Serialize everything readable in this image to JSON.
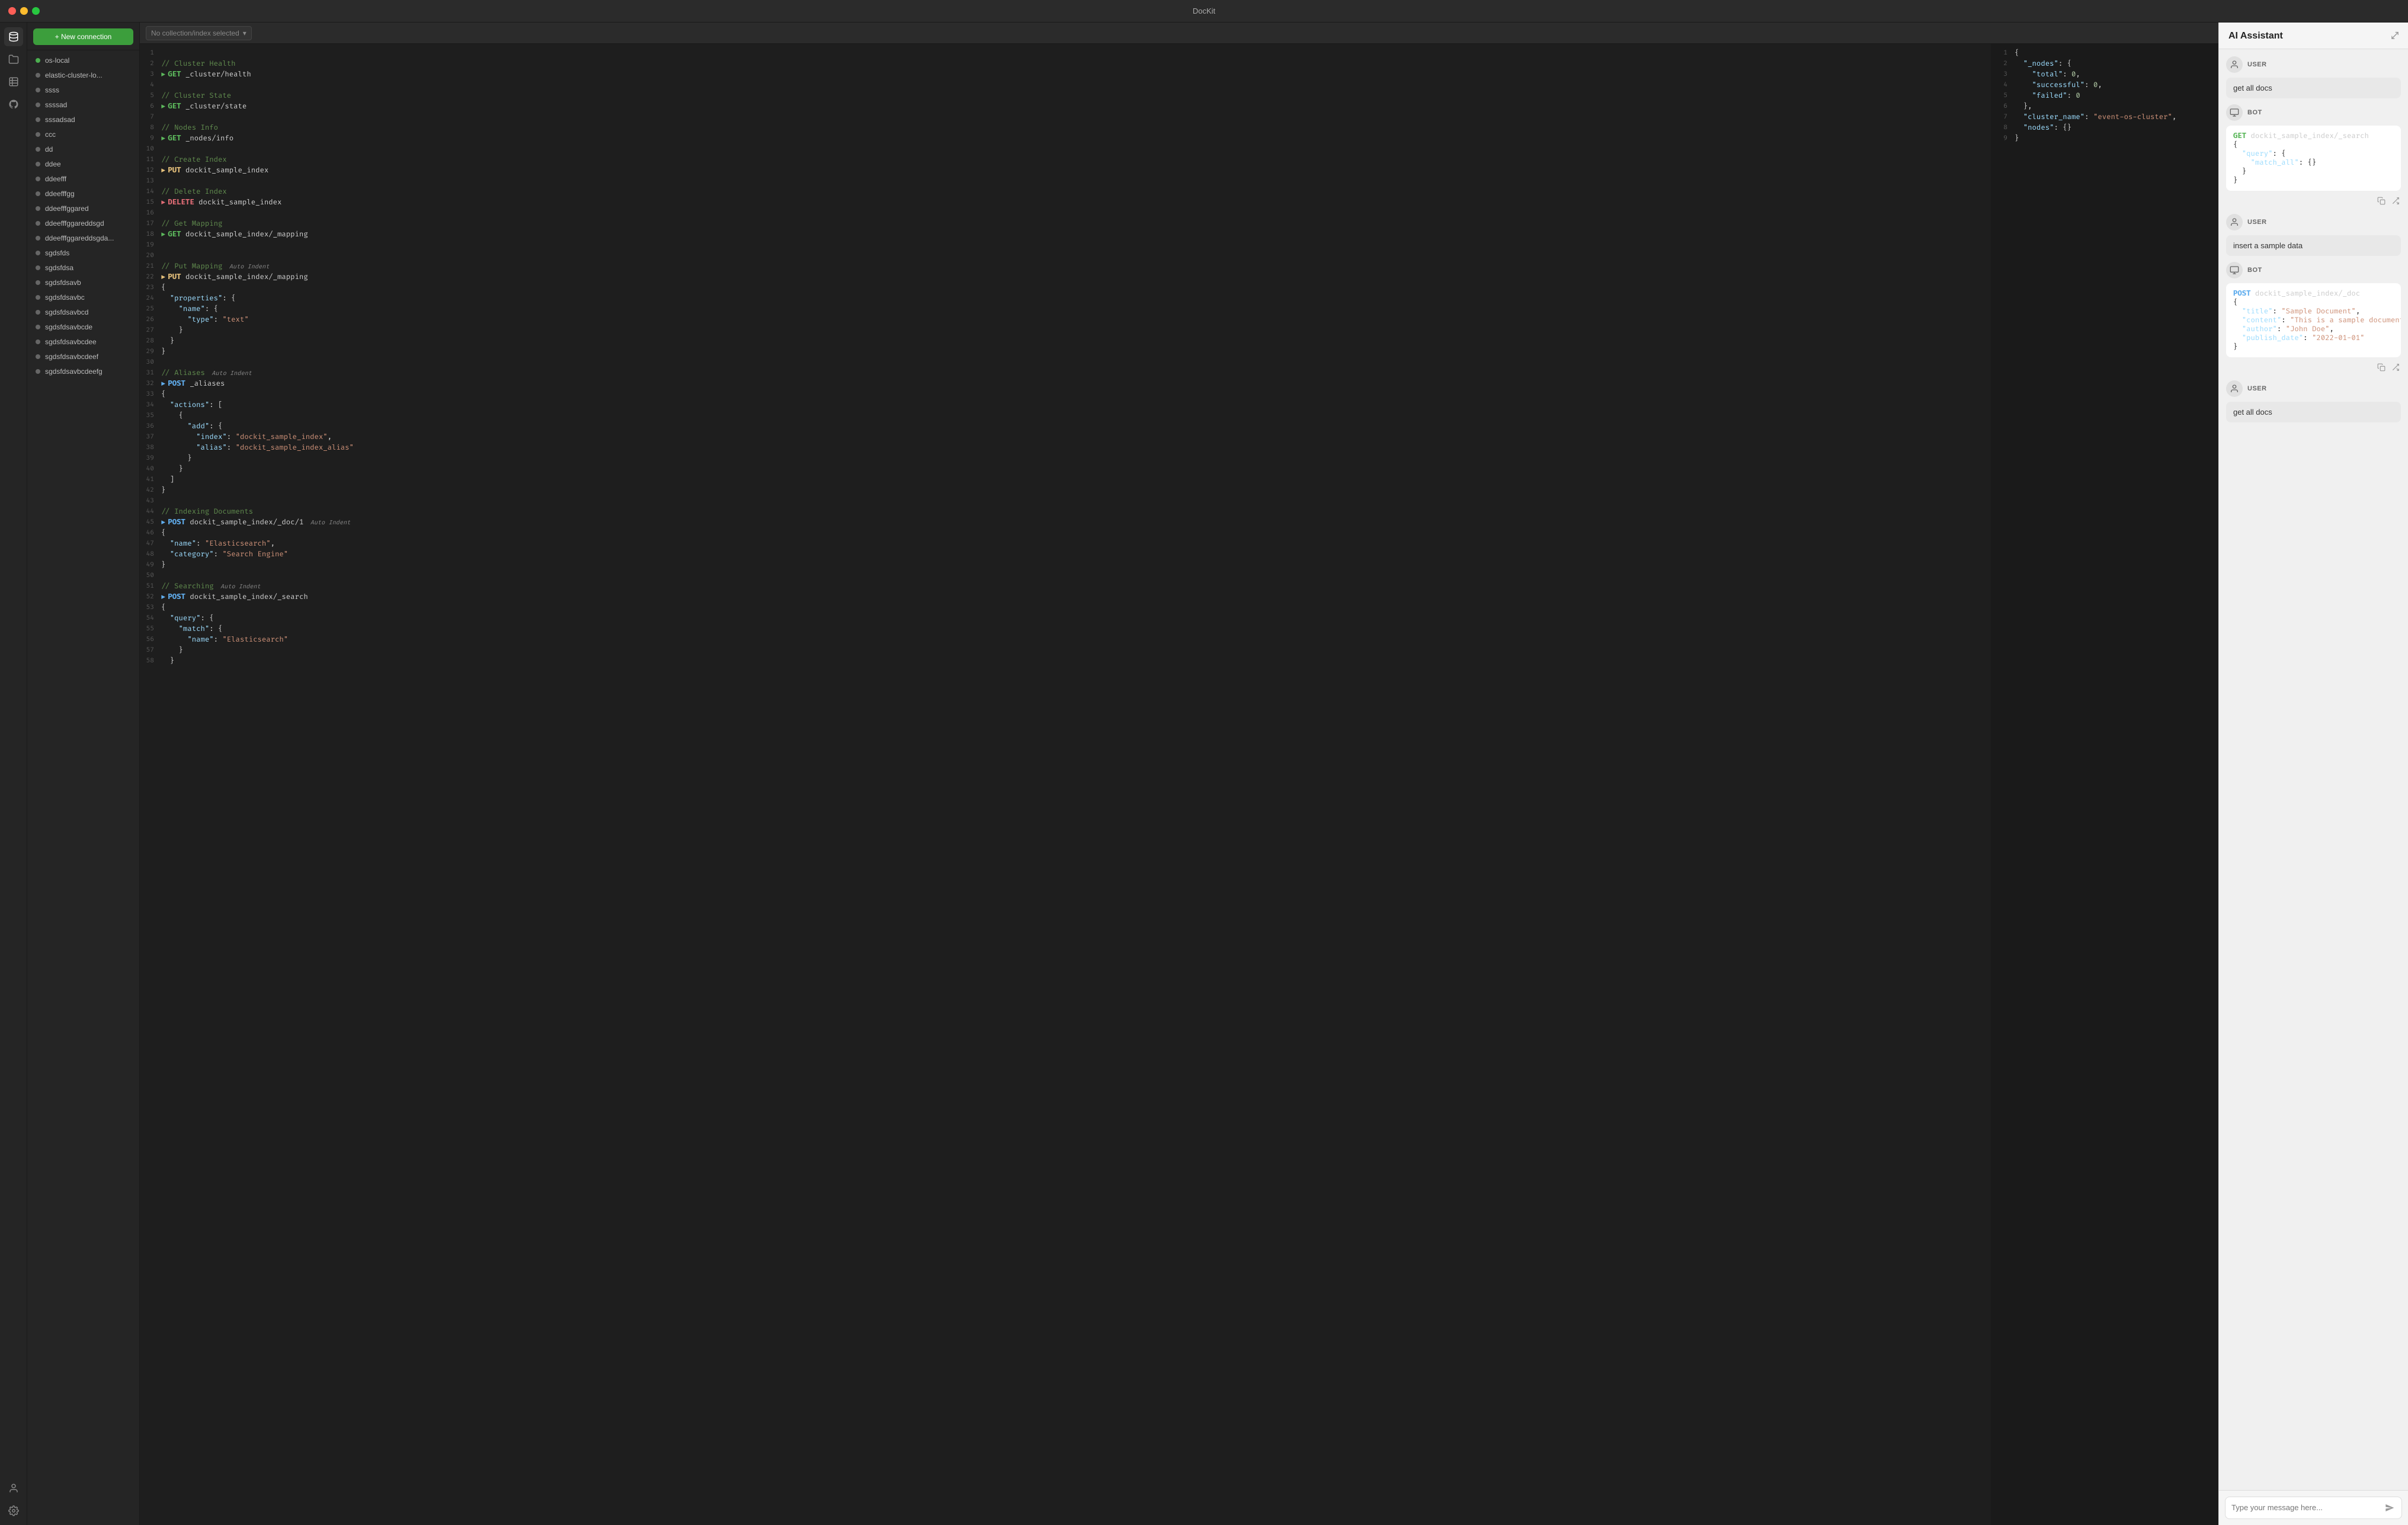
{
  "app": {
    "title": "DocKit"
  },
  "titlebar": {
    "title": "DocKit"
  },
  "sidebar": {
    "new_connection_label": "+ New connection",
    "connections": [
      {
        "id": "os-local",
        "label": "os-local",
        "status": "green"
      },
      {
        "id": "elastic-cluster",
        "label": "elastic-cluster-lo...",
        "status": "gray"
      },
      {
        "id": "ssss",
        "label": "ssss",
        "status": "gray"
      },
      {
        "id": "ssssad",
        "label": "ssssad",
        "status": "gray"
      },
      {
        "id": "sssadsad",
        "label": "sssadsad",
        "status": "gray"
      },
      {
        "id": "ccc",
        "label": "ccc",
        "status": "gray"
      },
      {
        "id": "dd",
        "label": "dd",
        "status": "gray"
      },
      {
        "id": "ddee",
        "label": "ddee",
        "status": "gray"
      },
      {
        "id": "ddeefff",
        "label": "ddeefff",
        "status": "gray"
      },
      {
        "id": "ddeefffgg",
        "label": "ddeefffgg",
        "status": "gray"
      },
      {
        "id": "ddeefffggared",
        "label": "ddeefffggared",
        "status": "gray"
      },
      {
        "id": "ddeefffggareddsgd",
        "label": "ddeefffggareddsgd",
        "status": "gray"
      },
      {
        "id": "ddeefffggareddsgda",
        "label": "ddeefffggareddsgda...",
        "status": "gray"
      },
      {
        "id": "sgdsfds",
        "label": "sgdsfds",
        "status": "gray"
      },
      {
        "id": "sgdsfdsа",
        "label": "sgdsfdsа",
        "status": "gray"
      },
      {
        "id": "sgdsfdsavb",
        "label": "sgdsfdsavb",
        "status": "gray"
      },
      {
        "id": "sgdsfdsavbc",
        "label": "sgdsfdsavbc",
        "status": "gray"
      },
      {
        "id": "sgdsfdsavbcd",
        "label": "sgdsfdsavbcd",
        "status": "gray"
      },
      {
        "id": "sgdsfdsavbcde",
        "label": "sgdsfdsavbcde",
        "status": "gray"
      },
      {
        "id": "sgdsfdsavbcdee",
        "label": "sgdsfdsavbcdee",
        "status": "gray"
      },
      {
        "id": "sgdsfdsavbcdeef",
        "label": "sgdsfdsavbcdeef",
        "status": "gray"
      },
      {
        "id": "sgdsfdsavbcdeefg",
        "label": "sgdsfdsavbcdeefg",
        "status": "gray"
      }
    ]
  },
  "editor": {
    "collection_placeholder": "No collection/index selected",
    "lines": [
      {
        "num": 1,
        "content": ""
      },
      {
        "num": 2,
        "content": "// Cluster Health",
        "type": "comment"
      },
      {
        "num": 3,
        "content": "GET _cluster/health",
        "type": "method",
        "method": "GET",
        "runnable": true
      },
      {
        "num": 4,
        "content": ""
      },
      {
        "num": 5,
        "content": "// Cluster State",
        "type": "comment"
      },
      {
        "num": 6,
        "content": "GET _cluster/state",
        "type": "method",
        "method": "GET",
        "runnable": true
      },
      {
        "num": 7,
        "content": ""
      },
      {
        "num": 8,
        "content": "// Nodes Info",
        "type": "comment"
      },
      {
        "num": 9,
        "content": "GET _nodes/info",
        "type": "method",
        "method": "GET",
        "runnable": true
      },
      {
        "num": 10,
        "content": ""
      },
      {
        "num": 11,
        "content": "// Create Index",
        "type": "comment"
      },
      {
        "num": 12,
        "content": "PUT dockit_sample_index",
        "type": "method",
        "method": "PUT",
        "runnable": true
      },
      {
        "num": 13,
        "content": ""
      },
      {
        "num": 14,
        "content": "// Delete Index",
        "type": "comment"
      },
      {
        "num": 15,
        "content": "DELETE dockit_sample_index",
        "type": "method",
        "method": "DELETE",
        "runnable": true
      },
      {
        "num": 16,
        "content": ""
      },
      {
        "num": 17,
        "content": "// Get Mapping",
        "type": "comment"
      },
      {
        "num": 18,
        "content": "GET dockit_sample_index/_mapping",
        "type": "method",
        "method": "GET",
        "runnable": true
      },
      {
        "num": 19,
        "content": ""
      },
      {
        "num": 20,
        "content": ""
      },
      {
        "num": 21,
        "content": "// Put Mapping",
        "type": "comment",
        "label": "Auto Indent"
      },
      {
        "num": 22,
        "content": "PUT dockit_sample_index/_mapping",
        "type": "method",
        "method": "PUT",
        "runnable": true
      },
      {
        "num": 23,
        "content": "{"
      },
      {
        "num": 24,
        "content": "  \"properties\": {"
      },
      {
        "num": 25,
        "content": "    \"name\": {"
      },
      {
        "num": 26,
        "content": "      \"type\": \"text\""
      },
      {
        "num": 27,
        "content": "    }"
      },
      {
        "num": 28,
        "content": "  }"
      },
      {
        "num": 29,
        "content": "}"
      },
      {
        "num": 30,
        "content": ""
      },
      {
        "num": 31,
        "content": "// Aliases",
        "type": "comment",
        "label": "Auto Indent"
      },
      {
        "num": 32,
        "content": "POST _aliases",
        "type": "method",
        "method": "POST",
        "runnable": true
      },
      {
        "num": 33,
        "content": "{"
      },
      {
        "num": 34,
        "content": "  \"actions\": ["
      },
      {
        "num": 35,
        "content": "    {"
      },
      {
        "num": 36,
        "content": "      \"add\": {"
      },
      {
        "num": 37,
        "content": "        \"index\": \"dockit_sample_index\","
      },
      {
        "num": 38,
        "content": "        \"alias\": \"dockit_sample_index_alias\""
      },
      {
        "num": 39,
        "content": "      }"
      },
      {
        "num": 40,
        "content": "    }"
      },
      {
        "num": 41,
        "content": "  ]"
      },
      {
        "num": 42,
        "content": "}"
      },
      {
        "num": 43,
        "content": ""
      },
      {
        "num": 44,
        "content": "// Indexing Documents",
        "type": "comment"
      },
      {
        "num": 45,
        "content": "POST dockit_sample_index/_doc/1",
        "type": "method",
        "method": "POST",
        "runnable": true,
        "label": "Auto Indent"
      },
      {
        "num": 46,
        "content": "{"
      },
      {
        "num": 47,
        "content": "  \"name\": \"Elasticsearch\","
      },
      {
        "num": 48,
        "content": "  \"category\": \"Search Engine\""
      },
      {
        "num": 49,
        "content": "}"
      },
      {
        "num": 50,
        "content": ""
      },
      {
        "num": 51,
        "content": "// Searching",
        "type": "comment",
        "label": "Auto Indent"
      },
      {
        "num": 52,
        "content": "POST dockit_sample_index/_search",
        "type": "method",
        "method": "POST",
        "runnable": true
      },
      {
        "num": 53,
        "content": "{"
      },
      {
        "num": 54,
        "content": "  \"query\": {"
      },
      {
        "num": 55,
        "content": "    \"match\": {"
      },
      {
        "num": 56,
        "content": "      \"name\": \"Elasticsearch\""
      },
      {
        "num": 57,
        "content": "    }"
      },
      {
        "num": 58,
        "content": "  }"
      }
    ]
  },
  "result": {
    "lines": [
      "{ ",
      "  \"_nodes\": {",
      "    \"total\": 0,",
      "    \"successful\": 0,",
      "    \"failed\": 0",
      "  },",
      "  \"cluster_name\": \"event-os-cluster\",",
      "  \"nodes\": {}",
      "}"
    ]
  },
  "ai": {
    "title": "AI Assistant",
    "messages": [
      {
        "role": "USER",
        "type": "user",
        "text": "get all docs"
      },
      {
        "role": "BOT",
        "type": "bot",
        "code": "GET dockit_sample_index/_search\n{\n  \"query\": {\n    \"match_all\": {}\n  }\n}"
      },
      {
        "role": "USER",
        "type": "user",
        "text": "insert a sample data"
      },
      {
        "role": "BOT",
        "type": "bot",
        "code": "POST dockit_sample_index/_doc\n{\n  \"title\": \"Sample Document\",\n  \"content\": \"This is a sample document content\",\n  \"author\": \"John Doe\",\n  \"publish_date\": \"2022-01-01\"\n}"
      },
      {
        "role": "USER",
        "type": "user",
        "text": "get all docs"
      }
    ],
    "input_placeholder": "Type your message here...",
    "send_label": "send"
  },
  "icons": {
    "database": "🗄",
    "folder": "📁",
    "table": "☰",
    "github": "◎",
    "user": "👤",
    "settings": "⚙",
    "plus": "+",
    "send": "➤",
    "copy": "⧉",
    "insert": "⬐",
    "chevron_down": "▾",
    "expand": "⤢"
  }
}
